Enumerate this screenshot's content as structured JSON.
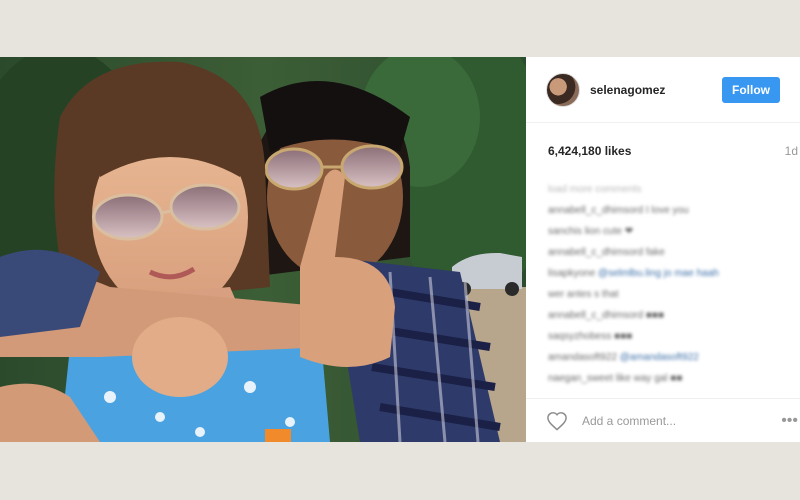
{
  "post": {
    "username": "selenagomez",
    "follow_label": "Follow",
    "likes": "6,424,180 likes",
    "age": "1d",
    "load_more": "load more comments",
    "comments": [
      {
        "user": "annabell_c_dhimsord",
        "text": "I love you"
      },
      {
        "user": "sanchis",
        "text": "lion cute ❤"
      },
      {
        "user": "annabell_c_dhimsord",
        "text": "fake"
      },
      {
        "user": "lisapkyone",
        "text": "@selmlbu.ling jo mae haah",
        "extra": "wer antes s that"
      },
      {
        "user": "annabell_c_dhimsord",
        "text": "■■■"
      },
      {
        "user": "saqsyzhobess",
        "text": "■■■"
      },
      {
        "user": "amandasoft922",
        "text": "@amandasoft922"
      },
      {
        "user": "naegan_sweet",
        "text": "like way gal ■■"
      }
    ],
    "add_comment_placeholder": "Add a comment...",
    "more_icon": "•••"
  },
  "colors": {
    "accent": "#3897f0",
    "page_bg": "#e6e4dc"
  }
}
